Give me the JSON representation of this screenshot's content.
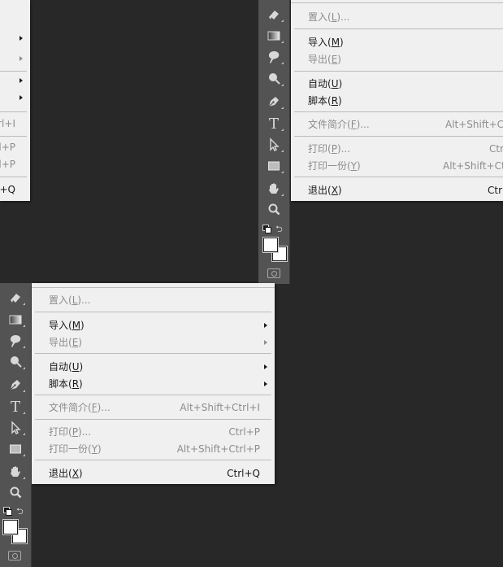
{
  "menu": {
    "items": [
      {
        "label": "置入(",
        "key": "L",
        "tail": ")...",
        "shortcut": "",
        "submenu": false,
        "disabled": true
      },
      {
        "label": "导入(",
        "key": "M",
        "tail": ")",
        "shortcut": "",
        "submenu": true,
        "disabled": false
      },
      {
        "label": "导出(",
        "key": "E",
        "tail": ")",
        "shortcut": "",
        "submenu": true,
        "disabled": true
      },
      {
        "label": "自动(",
        "key": "U",
        "tail": ")",
        "shortcut": "",
        "submenu": true,
        "disabled": false
      },
      {
        "label": "脚本(",
        "key": "R",
        "tail": ")",
        "shortcut": "",
        "submenu": true,
        "disabled": false
      },
      {
        "label": "文件简介(",
        "key": "F",
        "tail": ")...",
        "shortcut": "Alt+Shift+Ctrl+I",
        "submenu": false,
        "disabled": true
      },
      {
        "label": "打印(",
        "key": "P",
        "tail": ")...",
        "shortcut": "Ctrl+P",
        "submenu": false,
        "disabled": true
      },
      {
        "label": "打印一份(",
        "key": "Y",
        "tail": ")",
        "shortcut": "Alt+Shift+Ctrl+P",
        "submenu": false,
        "disabled": true
      },
      {
        "label": "退出(",
        "key": "X",
        "tail": ")",
        "shortcut": "Ctrl+Q",
        "submenu": false,
        "disabled": false
      }
    ],
    "top_left_fragments": [
      "rl+I",
      "l+P",
      "l+P",
      "+Q"
    ],
    "top_right_shortcuts": [
      "Alt+Shift+Ct",
      "Ctr",
      "Alt+Shift+Ctr",
      "Ctrl"
    ]
  },
  "toolbar": {
    "tools": [
      "eraser-tool-icon",
      "gradient-tool-icon",
      "blur-tool-icon",
      "dodge-tool-icon",
      "pen-tool-icon",
      "type-tool-icon",
      "path-selection-tool-icon",
      "rectangle-tool-icon",
      "hand-tool-icon",
      "zoom-tool-icon"
    ],
    "type_glyph": "T"
  },
  "colors": {
    "background": "#282828",
    "toolbar": "#535353",
    "menu": "#f0f0f0",
    "disabled_text": "#8c8c8c"
  }
}
